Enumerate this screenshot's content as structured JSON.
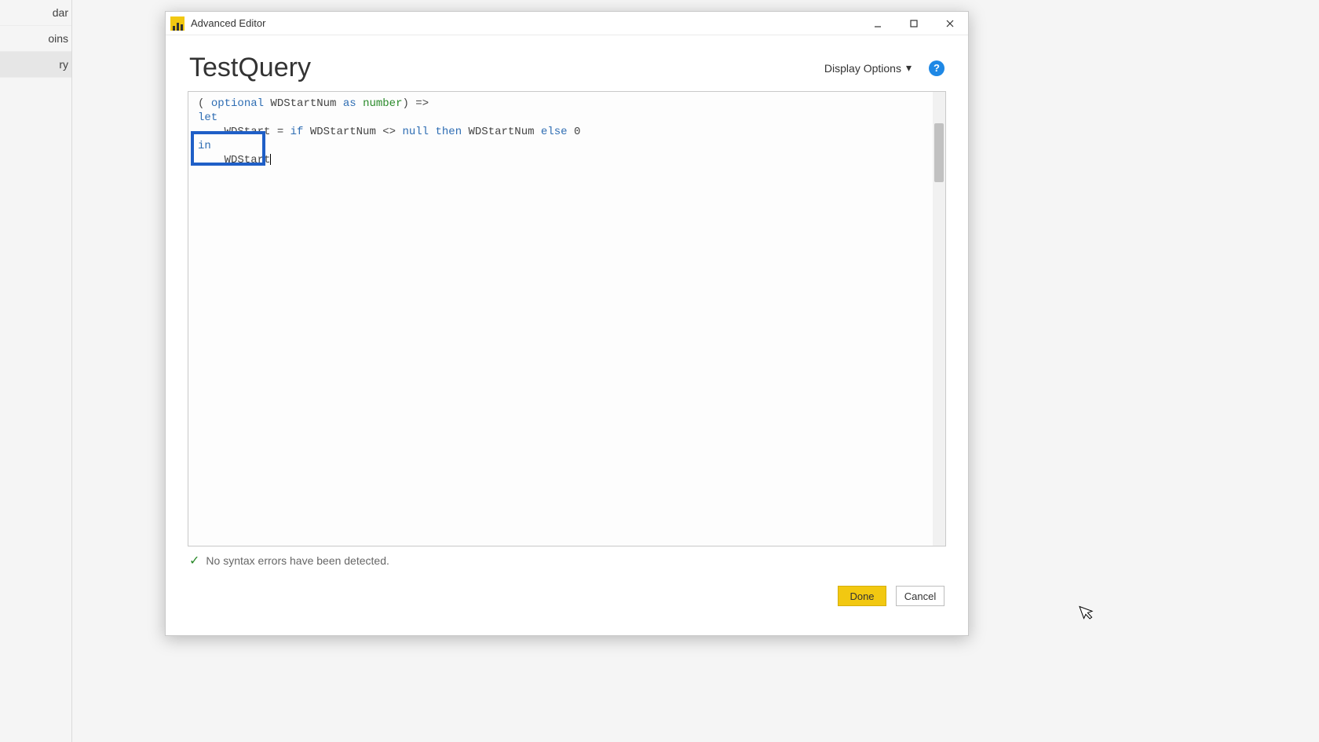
{
  "sidebar": {
    "items": [
      {
        "label": "dar"
      },
      {
        "label": "oins"
      },
      {
        "label": "ry"
      }
    ],
    "selected_index": 2
  },
  "window": {
    "title": "Advanced Editor",
    "query_name": "TestQuery",
    "display_options_label": "Display Options"
  },
  "code": {
    "line1_pre": "( ",
    "line1_kw_optional": "optional",
    "line1_mid": " WDStartNum ",
    "line1_kw_as": "as",
    "line1_sp": " ",
    "line1_type": "number",
    "line1_post": ") =>",
    "line2_kw_let": "let",
    "line3_indent": "    WDStart = ",
    "line3_kw_if": "if",
    "line3_mid1": " WDStartNum <> ",
    "line3_null": "null",
    "line3_sp": " ",
    "line3_kw_then": "then",
    "line3_mid2": " WDStartNum ",
    "line3_kw_else": "else",
    "line3_sp2": " ",
    "line3_zero": "0",
    "line4_kw_in": "in",
    "line5_indent": "    WDStart"
  },
  "status": {
    "message": "No syntax errors have been detected."
  },
  "buttons": {
    "done": "Done",
    "cancel": "Cancel"
  }
}
